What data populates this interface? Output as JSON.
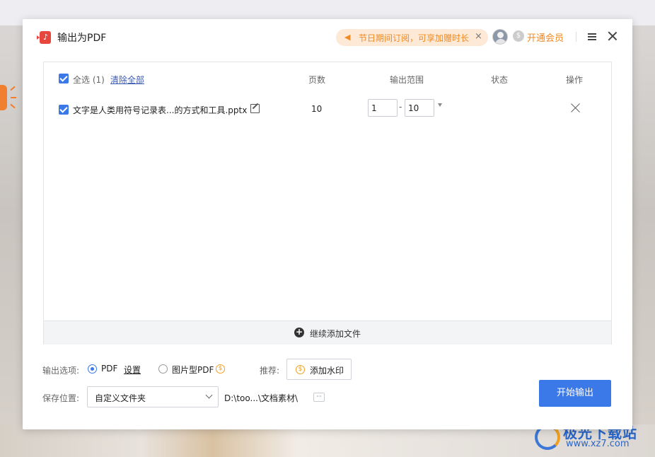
{
  "dialog": {
    "title": "输出为PDF",
    "promo_text": "节日期间订阅，可享加赠时长",
    "vip_label": "开通会员"
  },
  "table": {
    "select_all_label": "全选 (1)",
    "clear_all_label": "清除全部",
    "columns": {
      "pages": "页数",
      "range": "输出范围",
      "status": "状态",
      "action": "操作"
    },
    "rows": [
      {
        "checked": true,
        "filename": "文字是人类用符号记录表...的方式和工具.pptx",
        "pages": "10",
        "range_from": "1",
        "range_to": "10",
        "status": ""
      }
    ],
    "add_more_label": "继续添加文件"
  },
  "options": {
    "output_label": "输出选项:",
    "pdf_label": "PDF",
    "settings_label": "设置",
    "image_pdf_label": "图片型PDF",
    "selected": "PDF",
    "recommend_label": "推荐:",
    "watermark_label": "添加水印",
    "save_label": "保存位置:",
    "save_select": "自定义文件夹",
    "save_path": "D:\\too...\\文档素材\\",
    "more_label": "···",
    "start_label": "开始输出"
  },
  "watermark": {
    "name": "极光下载站",
    "url": "www.xz7.com"
  },
  "colors": {
    "accent": "#3b78e8",
    "promo": "#f08a24",
    "promo_bg": "#fde9d6",
    "app_icon": "#e8473e"
  }
}
